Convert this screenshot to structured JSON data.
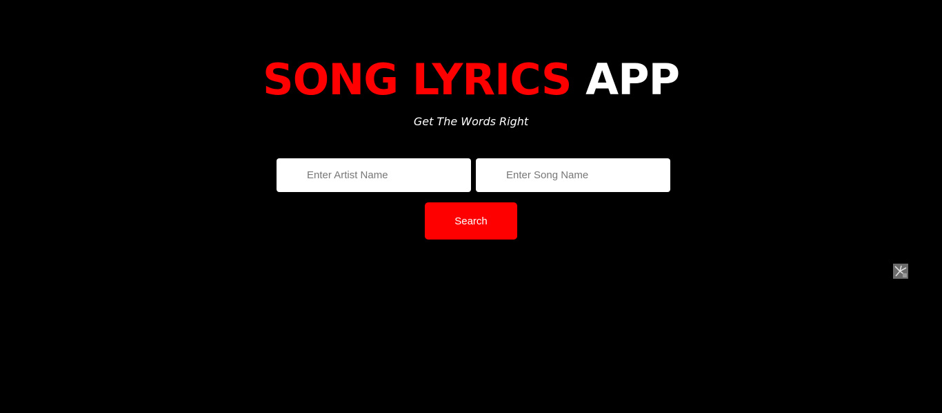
{
  "header": {
    "title_part1": "SONG LYRICS",
    "title_part2": "APP",
    "subtitle": "Get The Words Right"
  },
  "form": {
    "artist_placeholder": "Enter Artist Name",
    "artist_value": "",
    "song_placeholder": "Enter Song Name",
    "song_value": "",
    "search_label": "Search"
  },
  "widget": {
    "icon": "broken-image-icon"
  },
  "colors": {
    "background": "#000000",
    "accent": "#ff0000",
    "text": "#ffffff"
  }
}
